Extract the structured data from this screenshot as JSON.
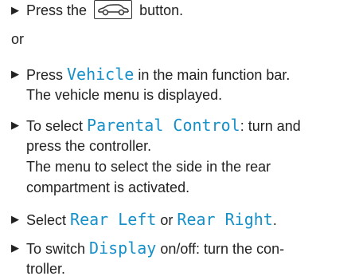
{
  "steps": [
    {
      "before": "Press the",
      "icon": "car-icon",
      "after": "button."
    },
    {
      "separator": "or"
    },
    {
      "prefix": "Press ",
      "highlight": "Vehicle",
      "suffix": " in the main function bar.",
      "result": "The vehicle menu is displayed."
    },
    {
      "prefix": "To select ",
      "highlight": "Parental Control",
      "suffix": ": turn and",
      "line2": "press the controller.",
      "result_line1": "The menu to select the side in the rear",
      "result_line2": "compartment is activated."
    },
    {
      "prefix": "Select ",
      "highlight_a": "Rear Left",
      "middle": " or ",
      "highlight_b": "Rear Right",
      "suffix": "."
    },
    {
      "prefix": "To switch ",
      "highlight": "Display",
      "suffix": " on/off: turn the con-",
      "line2": "troller."
    }
  ],
  "colors": {
    "highlight": "#1690c8",
    "text": "#222222"
  },
  "bullet_glyph": "▶"
}
